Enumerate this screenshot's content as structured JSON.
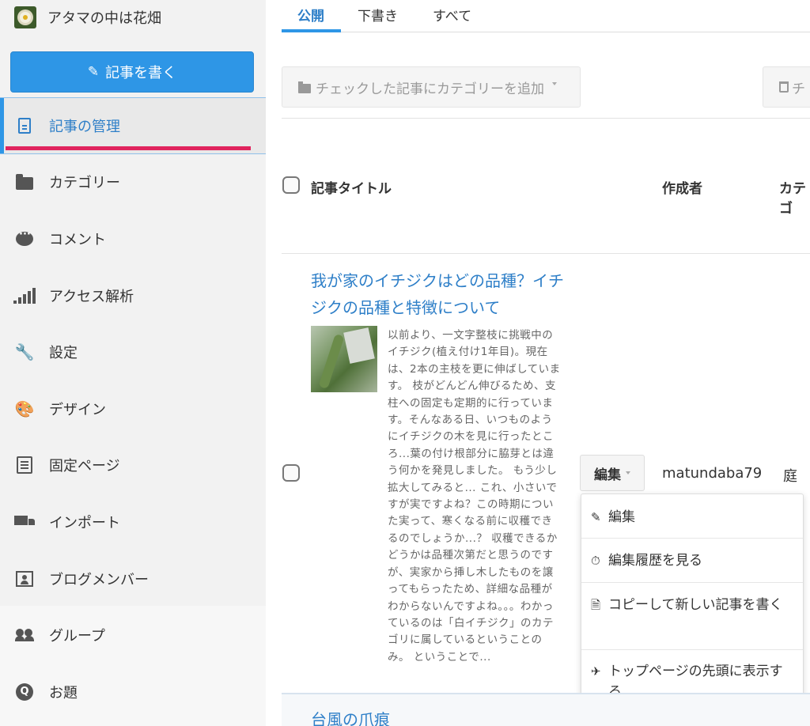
{
  "blog": {
    "title": "アタマの中は花畑"
  },
  "sidebar": {
    "write_button": "記事を書く",
    "items": [
      {
        "label": "記事の管理",
        "icon": "document-icon",
        "active": true
      },
      {
        "label": "カテゴリー",
        "icon": "folder-icon"
      },
      {
        "label": "コメント",
        "icon": "comment-icon"
      },
      {
        "label": "アクセス解析",
        "icon": "signal-bars-icon"
      },
      {
        "label": "設定",
        "icon": "wrench-icon"
      },
      {
        "label": "デザイン",
        "icon": "palette-icon"
      },
      {
        "label": "固定ページ",
        "icon": "page-icon"
      },
      {
        "label": "インポート",
        "icon": "truck-icon"
      },
      {
        "label": "ブログメンバー",
        "icon": "member-icon"
      },
      {
        "label": "グループ",
        "icon": "group-icon"
      },
      {
        "label": "お題",
        "icon": "q-icon"
      }
    ]
  },
  "tabs": [
    {
      "label": "公開",
      "active": true
    },
    {
      "label": "下書き"
    },
    {
      "label": "すべて"
    }
  ],
  "toolbar": {
    "add_category": "チェックした記事にカテゴリーを追加",
    "delete_partial": "チ"
  },
  "table": {
    "headers": {
      "title": "記事タイトル",
      "author": "作成者",
      "category_partial": "カテゴ"
    }
  },
  "post": {
    "title": "我が家のイチジクはどの品種？イチジクの品種と特徴について",
    "excerpt": "以前より、一文字整枝に挑戦中のイチジク(植え付け1年目)。現在は、2本の主枝を更に伸ばしています。 枝がどんどん伸びるため、支柱への固定も定期的に行っています。そんなある日、いつものようにイチジクの木を見に行ったところ...葉の付け根部分に脇芽とは違う何かを発見しました。 もう少し拡大してみると... これ、小さいですが実ですよね？この時期についた実って、寒くなる前に収穫できるのでしょうか...？ 収穫できるかどうかは品種次第だと思うのですが、実家から挿し木したものを譲ってもらったため、詳細な品種がわからないんですよね。。。わかっているのは「白イチジク」のカテゴリに属しているということのみ。 ということで...",
    "edit_label": "編集",
    "author": "matundaba79",
    "category": "庭"
  },
  "dropdown": {
    "items": [
      {
        "icon": "edit-icon",
        "glyph": "✎",
        "label": "編集"
      },
      {
        "icon": "stopwatch-icon",
        "glyph": "⏱",
        "label": "編集履歴を見る"
      },
      {
        "icon": "copy-doc-icon",
        "glyph": "🗎",
        "label": "コピーして新しい記事を書く"
      },
      {
        "icon": "pin-icon",
        "glyph": "✈",
        "label": "トップページの先頭に表示する"
      }
    ]
  },
  "next_post": {
    "title": "台風の爪痕"
  }
}
